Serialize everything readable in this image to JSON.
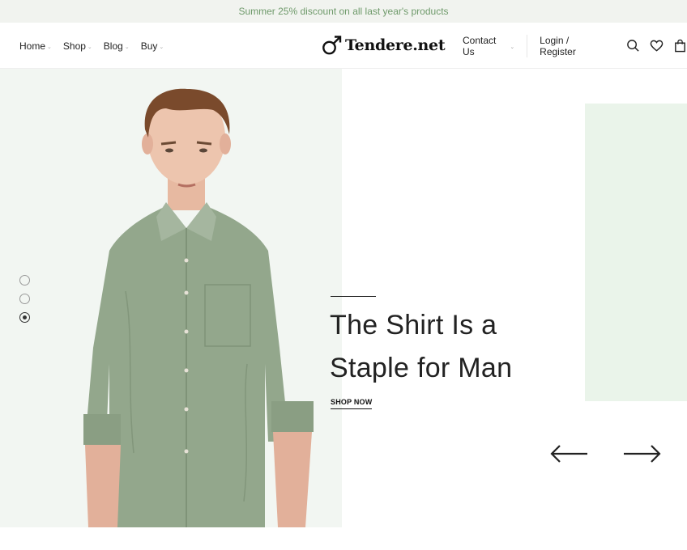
{
  "promo": {
    "text": "Summer 25% discount on all last year's products"
  },
  "nav": {
    "items": [
      {
        "label": "Home"
      },
      {
        "label": "Shop"
      },
      {
        "label": "Blog"
      },
      {
        "label": "Buy"
      }
    ],
    "chevron": "⌄"
  },
  "logo": {
    "text": "Tendere.net",
    "icon": "male-symbol-icon"
  },
  "header_right": {
    "contact": "Contact Us",
    "login": "Login / Register",
    "icons": [
      "search-icon",
      "heart-icon",
      "shopping-bag-icon"
    ]
  },
  "hero": {
    "title_line1": "The Shirt Is a",
    "title_line2": "Staple for Man",
    "cta": "SHOP NOW",
    "slides": 3,
    "active_slide": 3
  },
  "colors": {
    "promo_bg": "#f1f3ef",
    "promo_text": "#6f9a6b",
    "hero_left_bg": "#f2f6f2",
    "hero_accent_block": "#eaf4ea",
    "shirt": "#93a78c"
  }
}
